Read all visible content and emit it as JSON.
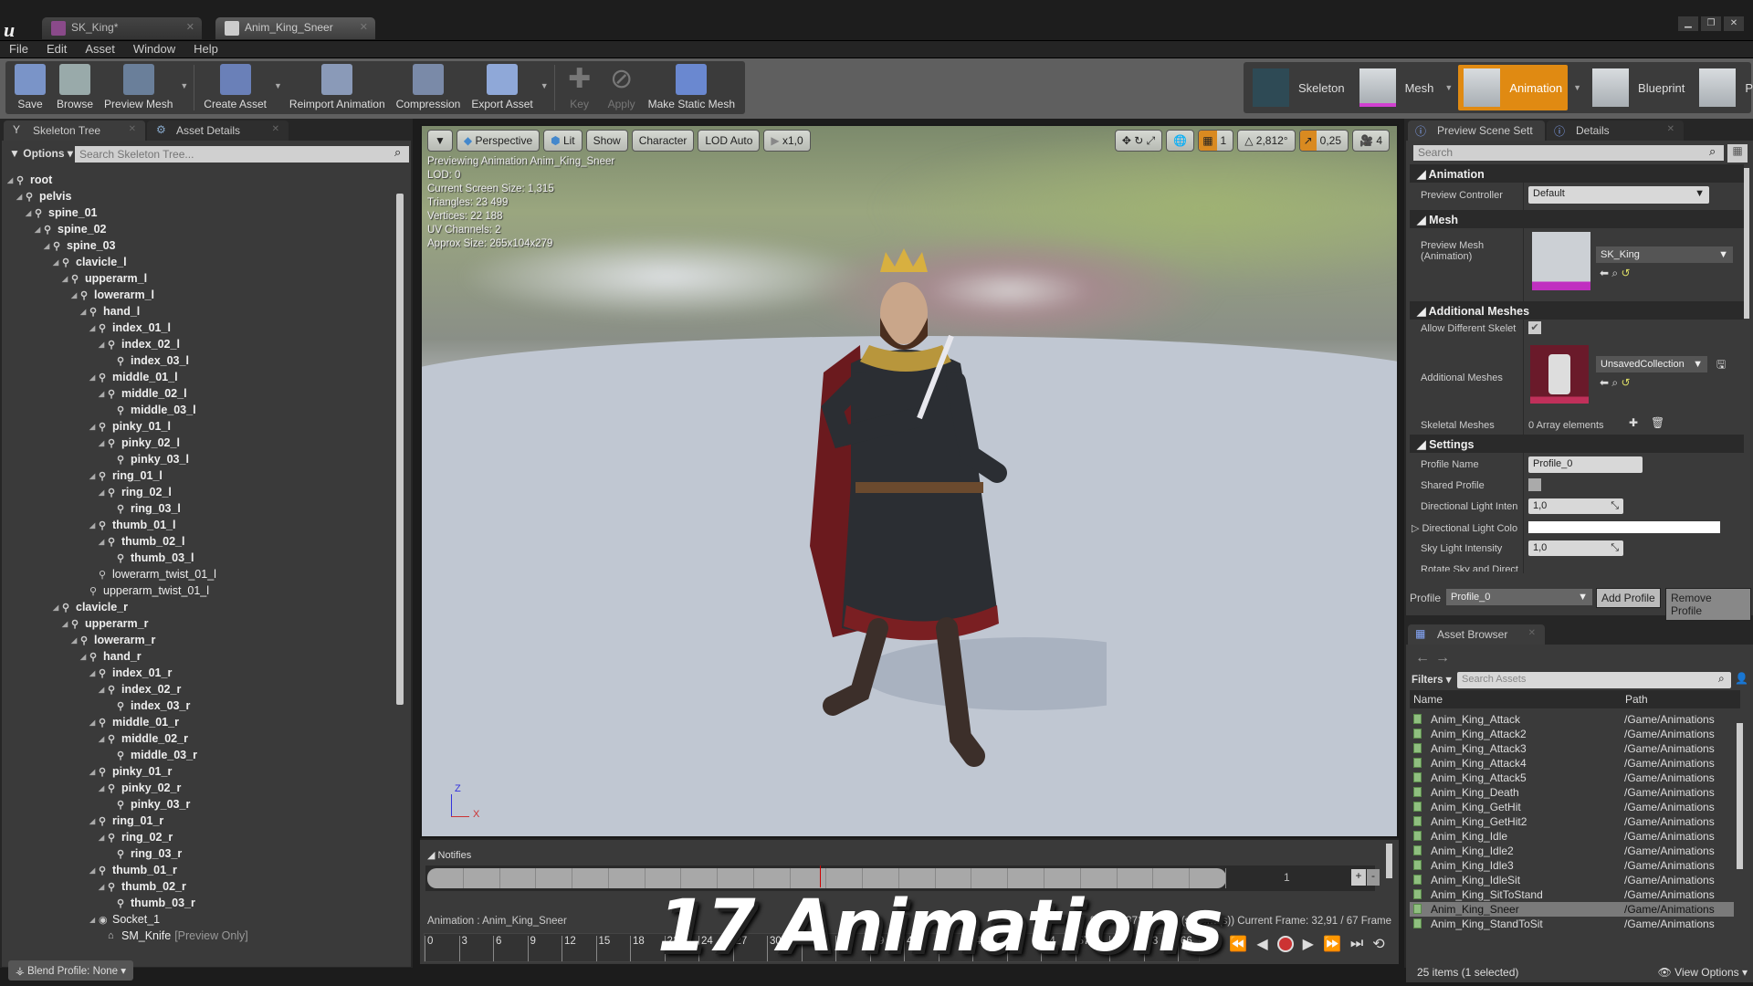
{
  "tabs": [
    {
      "label": "SK_King*",
      "icon": "skeletal-mesh-icon"
    },
    {
      "label": "Anim_King_Sneer",
      "icon": "animation-sequence-icon"
    }
  ],
  "menu": [
    "File",
    "Edit",
    "Asset",
    "Window",
    "Help"
  ],
  "toolbar": {
    "buttons": [
      {
        "label": "Save",
        "icon": "save-icon",
        "enabled": true
      },
      {
        "label": "Browse",
        "icon": "browse-icon",
        "enabled": true
      },
      {
        "label": "Preview Mesh",
        "icon": "preview-mesh-icon",
        "enabled": true,
        "dropdown": true
      },
      {
        "label": "Create Asset",
        "icon": "create-asset-icon",
        "enabled": true,
        "dropdown": true
      },
      {
        "label": "Reimport Animation",
        "icon": "reimport-icon",
        "enabled": true
      },
      {
        "label": "Compression",
        "icon": "compression-icon",
        "enabled": true
      },
      {
        "label": "Export Asset",
        "icon": "export-icon",
        "enabled": true,
        "dropdown": true
      },
      {
        "label": "Key",
        "icon": "plus-icon",
        "enabled": false
      },
      {
        "label": "Apply",
        "icon": "apply-icon",
        "enabled": false
      },
      {
        "label": "Make Static Mesh",
        "icon": "house-icon",
        "enabled": true
      }
    ]
  },
  "modes": [
    {
      "label": "Skeleton"
    },
    {
      "label": "Mesh",
      "dropdown": true
    },
    {
      "label": "Animation",
      "active": true,
      "dropdown": true
    },
    {
      "label": "Blueprint"
    },
    {
      "label": "Physics"
    }
  ],
  "left": {
    "tabs": [
      "Skeleton Tree",
      "Asset Details"
    ],
    "options_label": "Options",
    "search_placeholder": "Search Skeleton Tree...",
    "tree": [
      [
        "root",
        0,
        1
      ],
      [
        "pelvis",
        1,
        1
      ],
      [
        "spine_01",
        2,
        1
      ],
      [
        "spine_02",
        3,
        1
      ],
      [
        "spine_03",
        4,
        1
      ],
      [
        "clavicle_l",
        5,
        1
      ],
      [
        "upperarm_l",
        6,
        1
      ],
      [
        "lowerarm_l",
        7,
        1
      ],
      [
        "hand_l",
        8,
        1
      ],
      [
        "index_01_l",
        9,
        1
      ],
      [
        "index_02_l",
        10,
        1
      ],
      [
        "index_03_l",
        11,
        0
      ],
      [
        "middle_01_l",
        9,
        1
      ],
      [
        "middle_02_l",
        10,
        1
      ],
      [
        "middle_03_l",
        11,
        0
      ],
      [
        "pinky_01_l",
        9,
        1
      ],
      [
        "pinky_02_l",
        10,
        1
      ],
      [
        "pinky_03_l",
        11,
        0
      ],
      [
        "ring_01_l",
        9,
        1
      ],
      [
        "ring_02_l",
        10,
        1
      ],
      [
        "ring_03_l",
        11,
        0
      ],
      [
        "thumb_01_l",
        9,
        1
      ],
      [
        "thumb_02_l",
        10,
        1
      ],
      [
        "thumb_03_l",
        11,
        0
      ],
      [
        "lowerarm_twist_01_l",
        9,
        0,
        "n"
      ],
      [
        "upperarm_twist_01_l",
        8,
        0,
        "n"
      ],
      [
        "clavicle_r",
        5,
        1
      ],
      [
        "upperarm_r",
        6,
        1
      ],
      [
        "lowerarm_r",
        7,
        1
      ],
      [
        "hand_r",
        8,
        1
      ],
      [
        "index_01_r",
        9,
        1
      ],
      [
        "index_02_r",
        10,
        1
      ],
      [
        "index_03_r",
        11,
        0
      ],
      [
        "middle_01_r",
        9,
        1
      ],
      [
        "middle_02_r",
        10,
        1
      ],
      [
        "middle_03_r",
        11,
        0
      ],
      [
        "pinky_01_r",
        9,
        1
      ],
      [
        "pinky_02_r",
        10,
        1
      ],
      [
        "pinky_03_r",
        11,
        0
      ],
      [
        "ring_01_r",
        9,
        1
      ],
      [
        "ring_02_r",
        10,
        1
      ],
      [
        "ring_03_r",
        11,
        0
      ],
      [
        "thumb_01_r",
        9,
        1
      ],
      [
        "thumb_02_r",
        10,
        1
      ],
      [
        "thumb_03_r",
        11,
        0
      ],
      [
        "Socket_1",
        9,
        1,
        "n"
      ],
      [
        "SM_Knife",
        10,
        0,
        "n",
        "[Preview Only]"
      ]
    ],
    "blend_profile": "Blend Profile: None"
  },
  "viewport": {
    "buttons": [
      "Perspective",
      "Lit",
      "Show",
      "Character",
      "LOD Auto",
      "x1,0"
    ],
    "right_values": [
      "1",
      "2,812°",
      "0,25",
      "4"
    ],
    "info": [
      "Previewing Animation Anim_King_Sneer",
      "LOD: 0",
      "Current Screen Size: 1,315",
      "Triangles: 23 499",
      "Vertices: 22 188",
      "UV Channels: 2",
      "Approx Size: 265x104x279"
    ],
    "axis": {
      "z": "Z",
      "x": "X"
    }
  },
  "notifies": {
    "label": "Notifies",
    "track_number": "1",
    "plus": "+",
    "minus": "-",
    "playhead_fraction": 0.491
  },
  "anim_info": {
    "left": "Animation :  Anim_King_Sneer",
    "right": "%  ...: 1,371 / 2,792 (second(s)) Current Frame:  32,91 / 67 Frame"
  },
  "timeline": {
    "ticks": [
      "0",
      "3",
      "6",
      "9",
      "12",
      "15",
      "18",
      "21",
      "24",
      "27",
      "30",
      "33",
      "36",
      "39",
      "42",
      "45",
      "48",
      "51",
      "54",
      "57",
      "60",
      "63",
      "66"
    ]
  },
  "overlay_text": "17 Animations",
  "right": {
    "tabs": [
      "Preview Scene Sett",
      "Details"
    ],
    "search_placeholder": "Search",
    "sections": {
      "animation": "Animation",
      "mesh": "Mesh",
      "additional": "Additional Meshes",
      "settings": "Settings"
    },
    "preview_controller": {
      "label": "Preview Controller",
      "value": "Default"
    },
    "preview_mesh": {
      "label": "Preview Mesh (Animation)",
      "value": "SK_King"
    },
    "allow_diff": {
      "label": "Allow Different Skelet",
      "checked": true
    },
    "additional_meshes": {
      "label": "Additional Meshes",
      "value": "UnsavedCollection"
    },
    "skeletal_meshes": {
      "label": "Skeletal Meshes",
      "value": "0 Array elements"
    },
    "profile_name": {
      "label": "Profile Name",
      "value": "Profile_0"
    },
    "shared_profile": {
      "label": "Shared Profile",
      "checked": false
    },
    "dir_light_int": {
      "label": "Directional Light Inten",
      "value": "1,0"
    },
    "dir_light_col": {
      "label": "Directional Light Colo",
      "value": "#ffffff"
    },
    "sky_light": {
      "label": "Sky Light Intensity",
      "value": "1,0"
    },
    "rotate_sky": {
      "label": "Rotate Sky and Direct"
    },
    "profile_bar": {
      "label": "Profile",
      "value": "Profile_0",
      "add": "Add Profile",
      "remove": "Remove Profile"
    }
  },
  "asset_browser": {
    "tab": "Asset Browser",
    "filters": "Filters",
    "search_placeholder": "Search Assets",
    "columns": [
      "Name",
      "Path"
    ],
    "rows": [
      [
        "Anim_King_Attack",
        "/Game/Animations"
      ],
      [
        "Anim_King_Attack2",
        "/Game/Animations"
      ],
      [
        "Anim_King_Attack3",
        "/Game/Animations"
      ],
      [
        "Anim_King_Attack4",
        "/Game/Animations"
      ],
      [
        "Anim_King_Attack5",
        "/Game/Animations"
      ],
      [
        "Anim_King_Death",
        "/Game/Animations"
      ],
      [
        "Anim_King_GetHit",
        "/Game/Animations"
      ],
      [
        "Anim_King_GetHit2",
        "/Game/Animations"
      ],
      [
        "Anim_King_Idle",
        "/Game/Animations"
      ],
      [
        "Anim_King_Idle2",
        "/Game/Animations"
      ],
      [
        "Anim_King_Idle3",
        "/Game/Animations"
      ],
      [
        "Anim_King_IdleSit",
        "/Game/Animations"
      ],
      [
        "Anim_King_SitToStand",
        "/Game/Animations"
      ],
      [
        "Anim_King_Sneer",
        "/Game/Animations"
      ],
      [
        "Anim_King_StandToSit",
        "/Game/Animations"
      ]
    ],
    "selected_index": 13,
    "status": "25 items (1 selected)",
    "view_options": "View Options"
  },
  "colors": {
    "accent": "#e08a12",
    "mesh_accent": "#d040d0",
    "asset_icon": "#8fbf7f"
  }
}
